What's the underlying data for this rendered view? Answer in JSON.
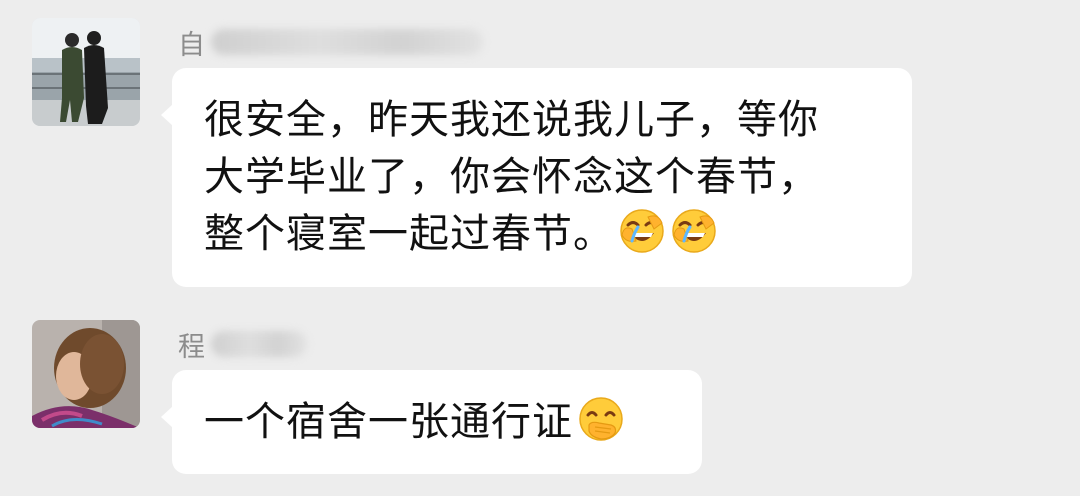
{
  "messages": [
    {
      "sender_visible": "自",
      "lines": [
        "很安全，昨天我还说我儿子，等你",
        "大学毕业了，你会怀念这个春节，",
        "整个寝室一起过春节。"
      ],
      "trailing_emojis": [
        "laughing-crying-emoji",
        "laughing-crying-emoji"
      ]
    },
    {
      "sender_visible": "程",
      "lines": [
        "一个宿舍一张通行证"
      ],
      "trailing_emojis": [
        "hand-over-mouth-emoji"
      ]
    }
  ],
  "colors": {
    "background": "#ededed",
    "bubble": "#ffffff",
    "text": "#111111",
    "sender": "#8c8c8c"
  }
}
